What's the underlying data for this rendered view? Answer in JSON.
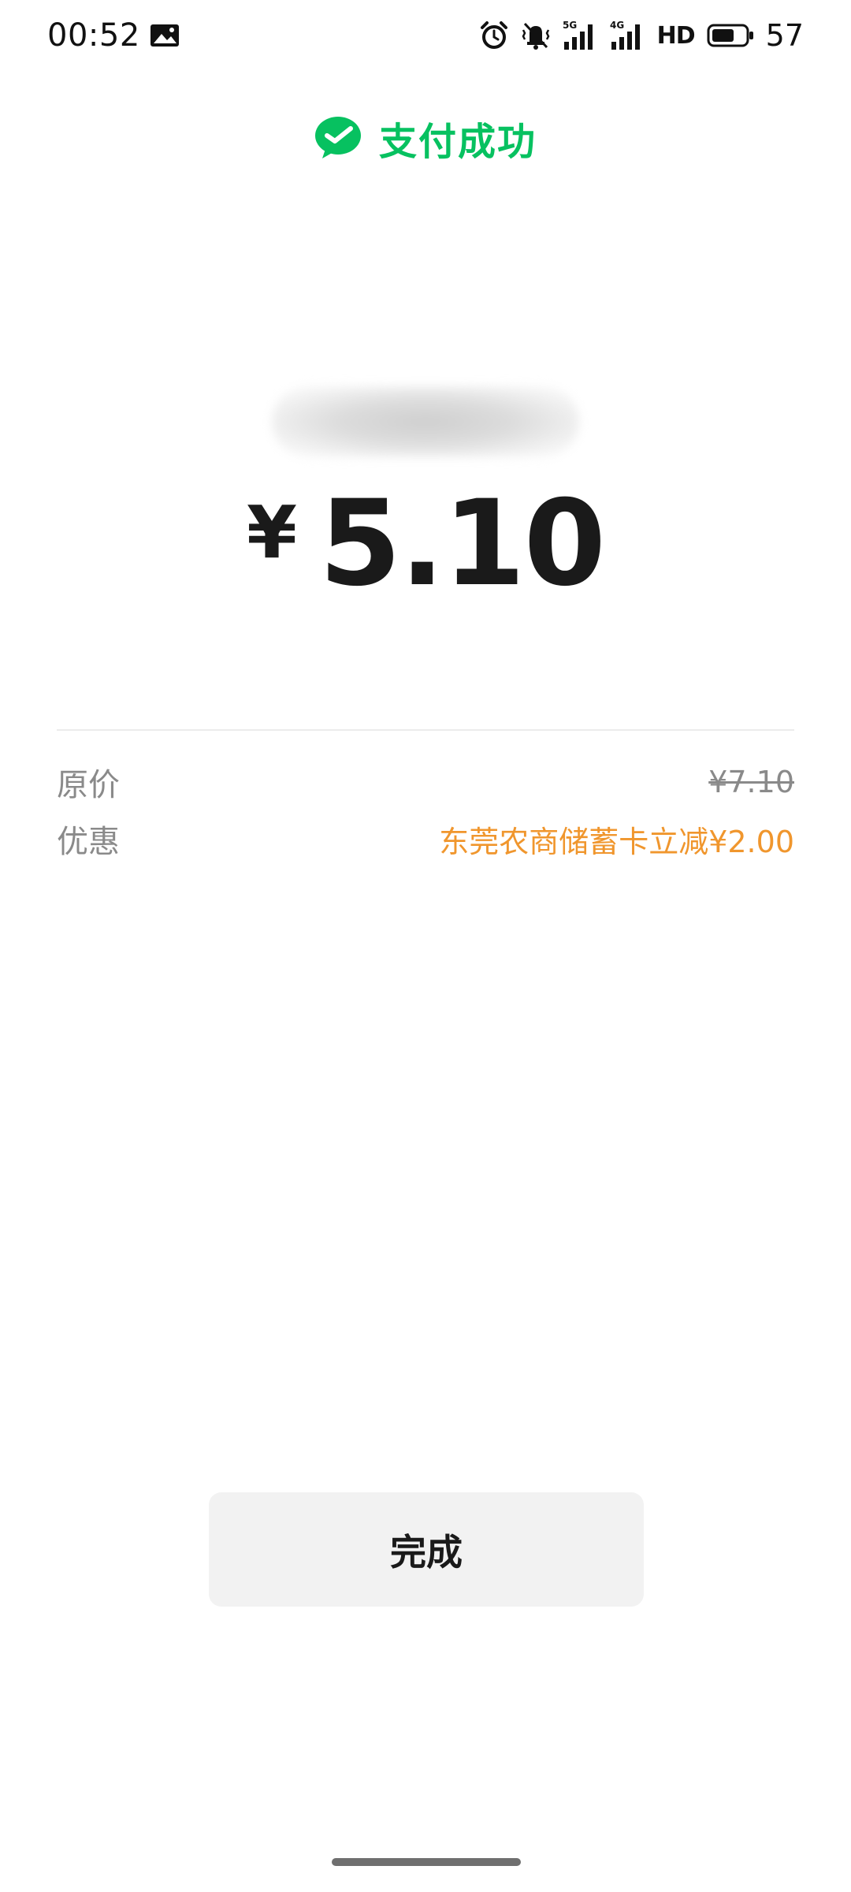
{
  "status_bar": {
    "time": "00:52",
    "network_5g": "5G",
    "network_4g": "4G",
    "hd_label": "HD",
    "battery_level": "57",
    "icons": [
      "gallery-icon",
      "alarm-icon",
      "vibrate-icon",
      "signal-icon",
      "battery-icon"
    ]
  },
  "header": {
    "title": "支付成功",
    "icon": "wechat-pay-icon",
    "accent_color": "#07c160"
  },
  "payment": {
    "currency_symbol": "¥",
    "amount": "5.10"
  },
  "details": {
    "original_price_label": "原价",
    "original_price_value": "¥7.10",
    "discount_label": "优惠",
    "discount_value": "东莞农商储蓄卡立减¥2.00",
    "discount_color": "#f0962d"
  },
  "actions": {
    "done_label": "完成"
  }
}
